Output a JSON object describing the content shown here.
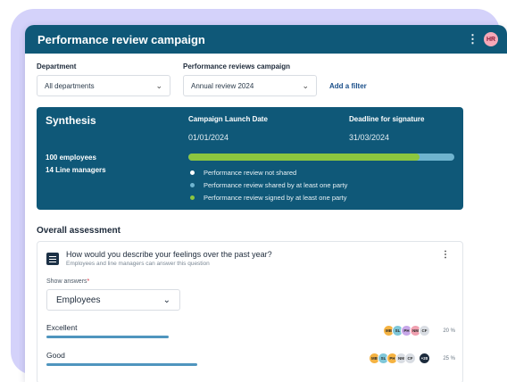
{
  "header": {
    "title": "Performance review campaign",
    "menu_icon": "kebab-icon",
    "user_initials": "HR"
  },
  "filters": {
    "department": {
      "label": "Department",
      "value": "All departments"
    },
    "campaign": {
      "label": "Performance reviews campaign",
      "value": "Annual review 2024"
    },
    "add_filter": "Add a filter"
  },
  "synthesis": {
    "title": "Synthesis",
    "launch_label": "Campaign Launch Date",
    "launch_date": "01/01/2024",
    "deadline_label": "Deadline for signature",
    "deadline_date": "31/03/2024",
    "employees": "100 employees",
    "managers": "14 Line managers",
    "progress": {
      "signed_fraction": 0.87,
      "shared_fraction": 0.13
    },
    "legend": [
      {
        "label": "Performance review not shared",
        "color": "#ffffff"
      },
      {
        "label": "Performance review shared by at least one party",
        "color": "#6fb4cf"
      },
      {
        "label": "Performance review signed by at least one party",
        "color": "#8cc63f"
      }
    ]
  },
  "overall": {
    "title": "Overall assessment",
    "question": {
      "icon": "list-icon",
      "title": "How would you describe your feelings over the past year?",
      "subtitle": "Employees and line managers can answer this question",
      "show_answers_label": "Show answers",
      "required_mark": "*",
      "show_answers_value": "Employees"
    },
    "answers": [
      {
        "label": "Excellent",
        "fraction": 0.3,
        "percent": "20 %",
        "avatars": [
          {
            "initials": "MB",
            "color": "#f5b342"
          },
          {
            "initials": "SL",
            "color": "#7fc7d9"
          },
          {
            "initials": "PH",
            "color": "#c7a6e8"
          },
          {
            "initials": "NM",
            "color": "#f0a0b0"
          },
          {
            "initials": "CF",
            "color": "#d9dde3"
          }
        ]
      },
      {
        "label": "Good",
        "fraction": 0.37,
        "percent": "25 %",
        "avatars": [
          {
            "initials": "MB",
            "color": "#f5b342"
          },
          {
            "initials": "SL",
            "color": "#7fc7d9"
          },
          {
            "initials": "PH",
            "color": "#f5b342"
          },
          {
            "initials": "NM",
            "color": "#d9dde3"
          },
          {
            "initials": "CF",
            "color": "#d9dde3"
          }
        ],
        "more": "+20"
      }
    ]
  }
}
